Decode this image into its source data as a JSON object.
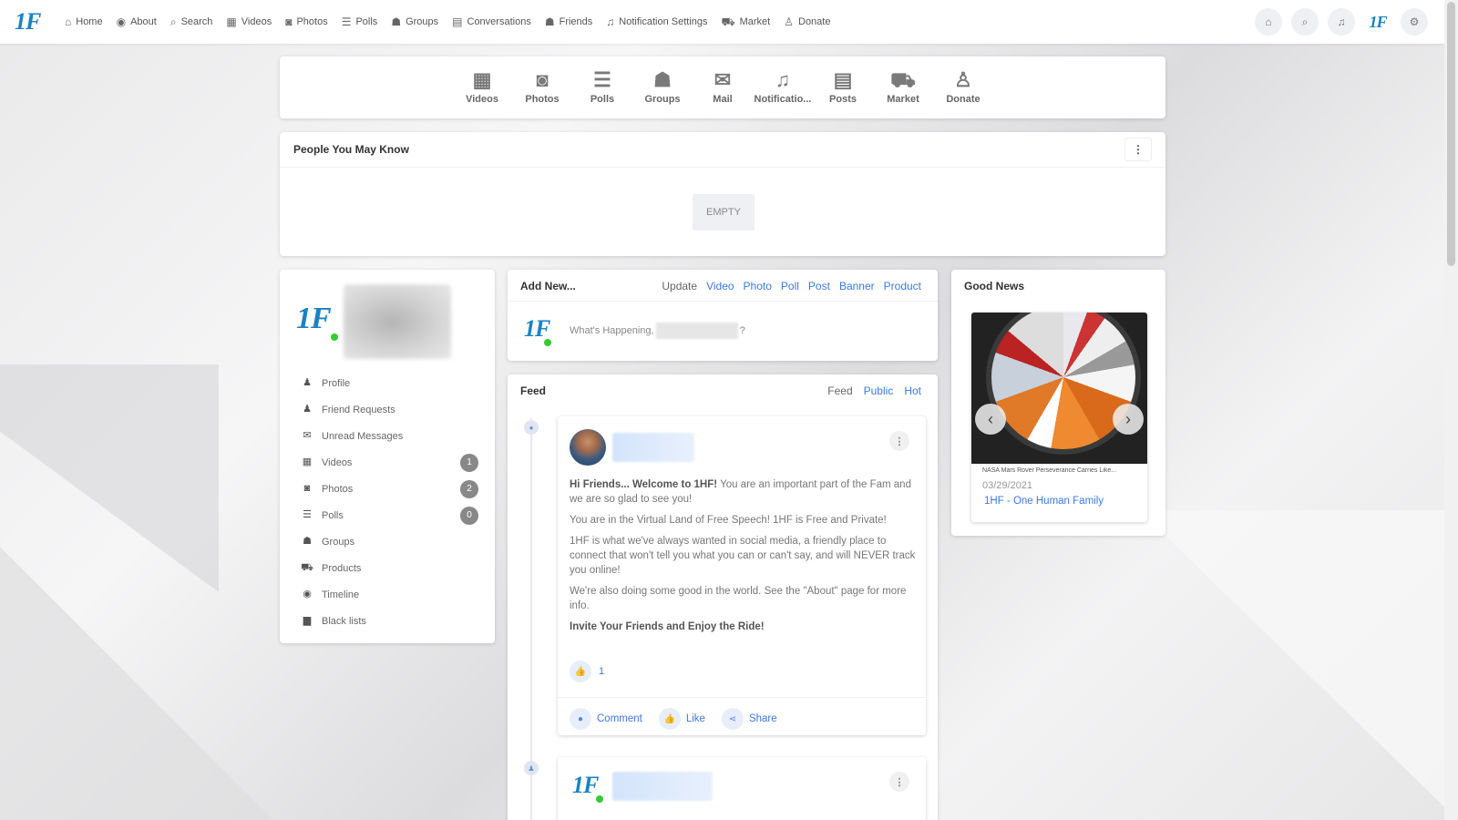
{
  "topbar": {
    "logo": "1F",
    "nav": [
      {
        "label": "Home",
        "icon": "home-icon",
        "glyph": "⌂"
      },
      {
        "label": "About",
        "icon": "info-icon",
        "glyph": "◉"
      },
      {
        "label": "Search",
        "icon": "search-icon",
        "glyph": "⌕"
      },
      {
        "label": "Videos",
        "icon": "video-icon",
        "glyph": "▦"
      },
      {
        "label": "Photos",
        "icon": "camera-icon",
        "glyph": "◙"
      },
      {
        "label": "Polls",
        "icon": "poll-icon",
        "glyph": "☰"
      },
      {
        "label": "Groups",
        "icon": "groups-icon",
        "glyph": "☗"
      },
      {
        "label": "Conversations",
        "icon": "chat-icon",
        "glyph": "▤"
      },
      {
        "label": "Friends",
        "icon": "friends-icon",
        "glyph": "☗"
      },
      {
        "label": "Notification Settings",
        "icon": "bell-icon",
        "glyph": "♫"
      },
      {
        "label": "Market",
        "icon": "cart-icon",
        "glyph": "⛟"
      },
      {
        "label": "Donate",
        "icon": "donate-icon",
        "glyph": "♙"
      }
    ],
    "right_icons": [
      "home-icon",
      "search-icon",
      "bell-icon",
      "logo-icon",
      "settings-icon"
    ],
    "right_logo": "1F"
  },
  "quicknav": [
    {
      "label": "Videos",
      "icon": "video-grid-icon",
      "glyph": "▦"
    },
    {
      "label": "Photos",
      "icon": "camera-icon",
      "glyph": "◙"
    },
    {
      "label": "Polls",
      "icon": "poll-list-icon",
      "glyph": "☰"
    },
    {
      "label": "Groups",
      "icon": "groups-icon",
      "glyph": "☗"
    },
    {
      "label": "Mail",
      "icon": "mail-icon",
      "glyph": "✉"
    },
    {
      "label": "Notificatio...",
      "icon": "bell-icon",
      "glyph": "♫"
    },
    {
      "label": "Posts",
      "icon": "document-icon",
      "glyph": "▤"
    },
    {
      "label": "Market",
      "icon": "cart-icon",
      "glyph": "⛟"
    },
    {
      "label": "Donate",
      "icon": "donate-icon",
      "glyph": "♙"
    }
  ],
  "people_you_may_know": {
    "title": "People You May Know",
    "menu": "⋮",
    "empty": "EMPTY"
  },
  "profile": {
    "logo": "1F",
    "menu": [
      {
        "label": "Profile",
        "icon": "user-icon",
        "glyph": "♟",
        "badge": ""
      },
      {
        "label": "Friend Requests",
        "icon": "friend-request-icon",
        "glyph": "♟",
        "badge": ""
      },
      {
        "label": "Unread Messages",
        "icon": "messages-icon",
        "glyph": "✉",
        "badge": ""
      },
      {
        "label": "Videos",
        "icon": "video-icon",
        "glyph": "▦",
        "badge": "1"
      },
      {
        "label": "Photos",
        "icon": "camera-icon",
        "glyph": "◙",
        "badge": "2"
      },
      {
        "label": "Polls",
        "icon": "poll-icon",
        "glyph": "☰",
        "badge": "0"
      },
      {
        "label": "Groups",
        "icon": "groups-icon",
        "glyph": "☗",
        "badge": ""
      },
      {
        "label": "Products",
        "icon": "cart-icon",
        "glyph": "⛟",
        "badge": ""
      },
      {
        "label": "Timeline",
        "icon": "timeline-icon",
        "glyph": "◉",
        "badge": ""
      },
      {
        "label": "Black lists",
        "icon": "lock-icon",
        "glyph": "▆",
        "badge": ""
      }
    ]
  },
  "add_new": {
    "title": "Add New...",
    "tabs": [
      "Update",
      "Video",
      "Photo",
      "Poll",
      "Post",
      "Banner",
      "Product"
    ],
    "logo": "1F",
    "prompt": "What's Happening,",
    "prompt_end": "?"
  },
  "feed": {
    "title": "Feed",
    "tabs": [
      "Feed",
      "Public",
      "Hot"
    ],
    "post1": {
      "menu": "⋮",
      "lines": [
        {
          "bold": "Hi Friends... Welcome to 1HF!",
          "text": " You are an important part of the Fam and we are so glad to see you!"
        },
        {
          "bold": "",
          "text": "You are in the Virtual Land of Free Speech! 1HF is Free and Private!"
        },
        {
          "bold": "",
          "text": "1HF is what we've always wanted in social media, a friendly place to connect that won't tell you what you can or can't say, and will NEVER track you online!"
        },
        {
          "bold": "",
          "text": "We're also doing some good in the world.  See the \"About\" page for more info."
        },
        {
          "bold": "Invite Your Friends and Enjoy the Ride!",
          "text": ""
        }
      ],
      "likes": "1",
      "actions": [
        {
          "label": "Comment",
          "icon": "comment-icon",
          "glyph": "●"
        },
        {
          "label": "Like",
          "icon": "thumbs-up-icon",
          "glyph": "👍"
        },
        {
          "label": "Share",
          "icon": "share-icon",
          "glyph": "⋖"
        }
      ]
    },
    "post2": {
      "logo": "1F",
      "menu": "⋮"
    }
  },
  "good_news": {
    "title": "Good News",
    "caption": "NASA Mars Rover Perseverance Carries Like...",
    "date": "03/29/2021",
    "link": "1HF - One Human Family",
    "prev": "‹",
    "next": "›"
  }
}
